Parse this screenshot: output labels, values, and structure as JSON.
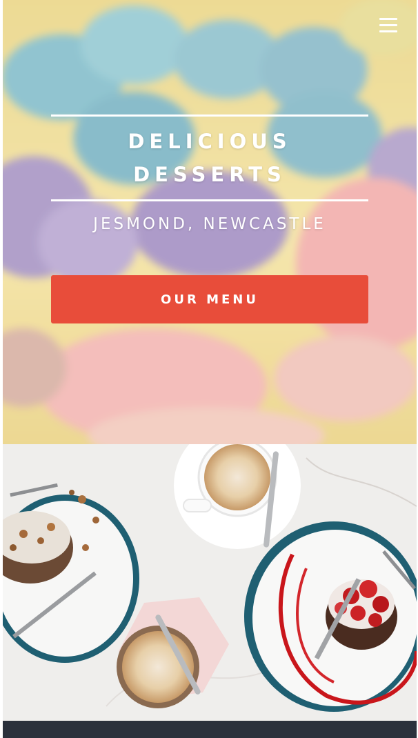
{
  "hero": {
    "title_line1": "DELICIOUS",
    "title_line2": "DESSERTS",
    "subtitle": "JESMOND, NEWCASTLE",
    "cta_label": "OUR MENU"
  },
  "nav": {
    "icon": "hamburger-menu-icon"
  },
  "colors": {
    "accent": "#e84d3a",
    "footer": "#2b313c",
    "text_on_hero": "#ffffff"
  },
  "images": {
    "hero": "blurred cupcakes with blue, purple and pink frosting",
    "photo": "two plates of pancakes with coffee cups on marble table"
  }
}
